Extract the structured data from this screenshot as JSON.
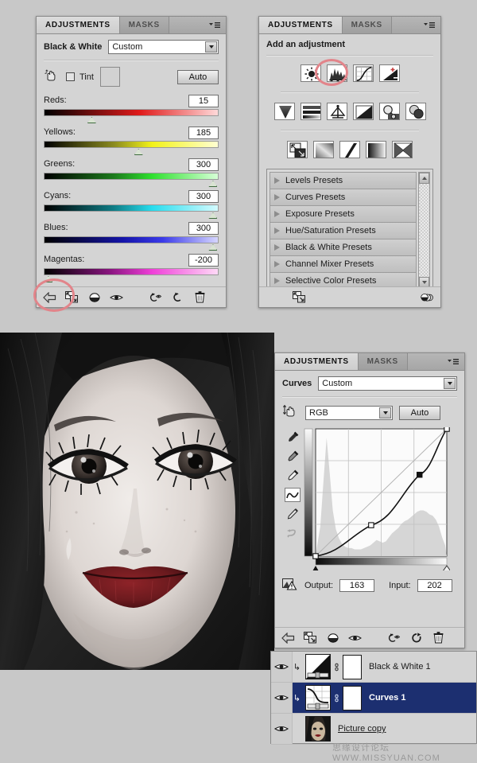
{
  "bw_panel": {
    "tabs": [
      {
        "label": "ADJUSTMENTS",
        "active": true
      },
      {
        "label": "MASKS",
        "active": false
      }
    ],
    "menu_icon": "panel-menu-icon",
    "title": "Black & White",
    "preset_value": "Custom",
    "targeted_tool_icon": "targeted-adjustment-hand-icon",
    "tint_label": "Tint",
    "auto_label": "Auto",
    "sliders": [
      {
        "name": "Reds:",
        "value": "15",
        "pos": 27
      },
      {
        "name": "Yellows:",
        "value": "185",
        "pos": 54
      },
      {
        "name": "Greens:",
        "value": "300",
        "pos": 97
      },
      {
        "name": "Cyans:",
        "value": "300",
        "pos": 97
      },
      {
        "name": "Blues:",
        "value": "300",
        "pos": 97
      },
      {
        "name": "Magentas:",
        "value": "-200",
        "pos": 2
      }
    ],
    "footer_icons": [
      "back-arrow-icon",
      "clip-to-layer-icon",
      "view-previous-state-icon",
      "toggle-visibility-eye-icon",
      "reset-icon",
      "reset-to-default-icon",
      "delete-trash-icon"
    ]
  },
  "add_panel": {
    "tabs": [
      {
        "label": "ADJUSTMENTS",
        "active": true
      },
      {
        "label": "MASKS",
        "active": false
      }
    ],
    "heading": "Add an adjustment",
    "icons_row1": [
      "brightness-contrast-icon",
      "levels-icon",
      "curves-icon",
      "exposure-icon"
    ],
    "icons_row2": [
      "vibrance-icon",
      "hue-saturation-icon",
      "color-balance-icon",
      "black-and-white-icon",
      "photo-filter-icon",
      "channel-mixer-icon"
    ],
    "icons_row3": [
      "invert-icon",
      "posterize-icon",
      "threshold-icon",
      "gradient-map-icon",
      "selective-color-icon"
    ],
    "presets": [
      "Levels Presets",
      "Curves Presets",
      "Exposure Presets",
      "Hue/Saturation Presets",
      "Black & White Presets",
      "Channel Mixer Presets",
      "Selective Color Presets"
    ],
    "footer_icons": [
      "clip-to-layer-icon",
      "view-states-icon"
    ]
  },
  "curves_panel": {
    "tabs": [
      {
        "label": "ADJUSTMENTS",
        "active": true
      },
      {
        "label": "MASKS",
        "active": false
      }
    ],
    "title": "Curves",
    "preset_value": "Custom",
    "channel_value": "RGB",
    "auto_label": "Auto",
    "targeted_tool_icon": "targeted-adjustment-hand-icon",
    "tools": [
      "black-point-eyedropper-icon",
      "gray-point-eyedropper-icon",
      "white-point-eyedropper-icon",
      "curve-edit-icon",
      "pencil-draw-icon",
      "smooth-curve-icon"
    ],
    "output_label": "Output:",
    "output_value": "163",
    "input_label": "Input:",
    "input_value": "202",
    "clip_warning_icon": "clipping-warning-icon",
    "footer_icons": [
      "back-arrow-icon",
      "clip-to-layer-icon",
      "view-previous-state-icon",
      "toggle-visibility-eye-icon",
      "reset-icon",
      "reset-to-default-icon",
      "delete-trash-icon"
    ]
  },
  "chart_data": {
    "type": "line",
    "title": "Curves RGB tone curve",
    "xlabel": "Input",
    "ylabel": "Output",
    "xlim": [
      0,
      255
    ],
    "ylim": [
      0,
      255
    ],
    "grid": true,
    "grid_divisions": 4,
    "series": [
      {
        "name": "RGB curve",
        "points": [
          {
            "input": 0,
            "output": 0,
            "type": "endpoint"
          },
          {
            "input": 108,
            "output": 62,
            "type": "control"
          },
          {
            "input": 202,
            "output": 163,
            "type": "selected"
          },
          {
            "input": 255,
            "output": 255,
            "type": "endpoint"
          }
        ]
      },
      {
        "name": "baseline-diagonal",
        "points": [
          {
            "input": 0,
            "output": 0
          },
          {
            "input": 255,
            "output": 255
          }
        ]
      }
    ],
    "histogram": [
      8,
      22,
      55,
      88,
      62,
      34,
      20,
      13,
      9,
      7,
      6,
      6,
      5,
      5,
      5,
      6,
      7,
      8,
      10,
      12,
      11,
      10,
      11,
      14,
      17,
      19,
      21,
      24,
      26,
      27,
      29,
      31,
      33,
      34,
      34,
      33,
      31,
      30,
      27,
      22,
      14,
      8
    ]
  },
  "layers_panel": {
    "rows": [
      {
        "name": "Black & White 1",
        "selected": false,
        "clipped": true,
        "thumb": "black-white-adjustment-thumb",
        "mask": "layer-mask-white",
        "eye": "eye-icon"
      },
      {
        "name": "Curves 1",
        "selected": true,
        "clipped": true,
        "thumb": "curves-adjustment-thumb",
        "mask": "layer-mask-white",
        "eye": "eye-icon"
      },
      {
        "name": "Picture copy",
        "selected": false,
        "clipped": false,
        "thumb": "photo-thumb",
        "mask": null,
        "eye": "eye-icon"
      }
    ]
  },
  "photo": {
    "alt_name": "portrait-black-and-white-red-lips",
    "lip_color": "#6b1a1e"
  },
  "watermark": "思缘设计论坛  WWW.MISSYUAN.COM",
  "colors": {
    "panel_bg": "#d4d4d4",
    "page_bg": "#c8c8c8",
    "selection_blue": "#1c2f70",
    "highlight_red": "#e2848a"
  }
}
